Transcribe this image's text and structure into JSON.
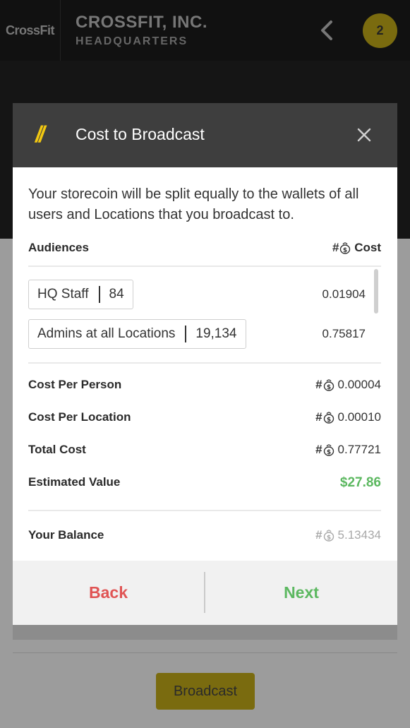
{
  "app": {
    "logo": "CrossFit",
    "title": "CROSSFIT, INC.",
    "subtitle": "HEADQUARTERS",
    "badge_count": "2",
    "broadcast_label": "Broadcast"
  },
  "modal": {
    "title": "Cost to Broadcast",
    "intro": "Your storecoin will be split equally to the wallets of all users and Locations that you broadcast to.",
    "audiences_label": "Audiences",
    "cost_header": "Cost",
    "currency_symbol": "#",
    "audiences": [
      {
        "name": "HQ Staff",
        "count": "84",
        "cost": "0.01904"
      },
      {
        "name": "Admins at all Locations",
        "count": "19,134",
        "cost": "0.75817"
      }
    ],
    "summary": {
      "cost_per_person_label": "Cost Per Person",
      "cost_per_person": "0.00004",
      "cost_per_location_label": "Cost Per Location",
      "cost_per_location": "0.00010",
      "total_cost_label": "Total Cost",
      "total_cost": "0.77721",
      "estimated_value_label": "Estimated Value",
      "estimated_value": "$27.86",
      "balance_label": "Your Balance",
      "balance": "5.13434"
    },
    "back_label": "Back",
    "next_label": "Next"
  },
  "colors": {
    "accent_yellow": "#f2c811",
    "positive_green": "#5cb860",
    "negative_red": "#e05454",
    "header_dark": "#3e3e3e"
  }
}
